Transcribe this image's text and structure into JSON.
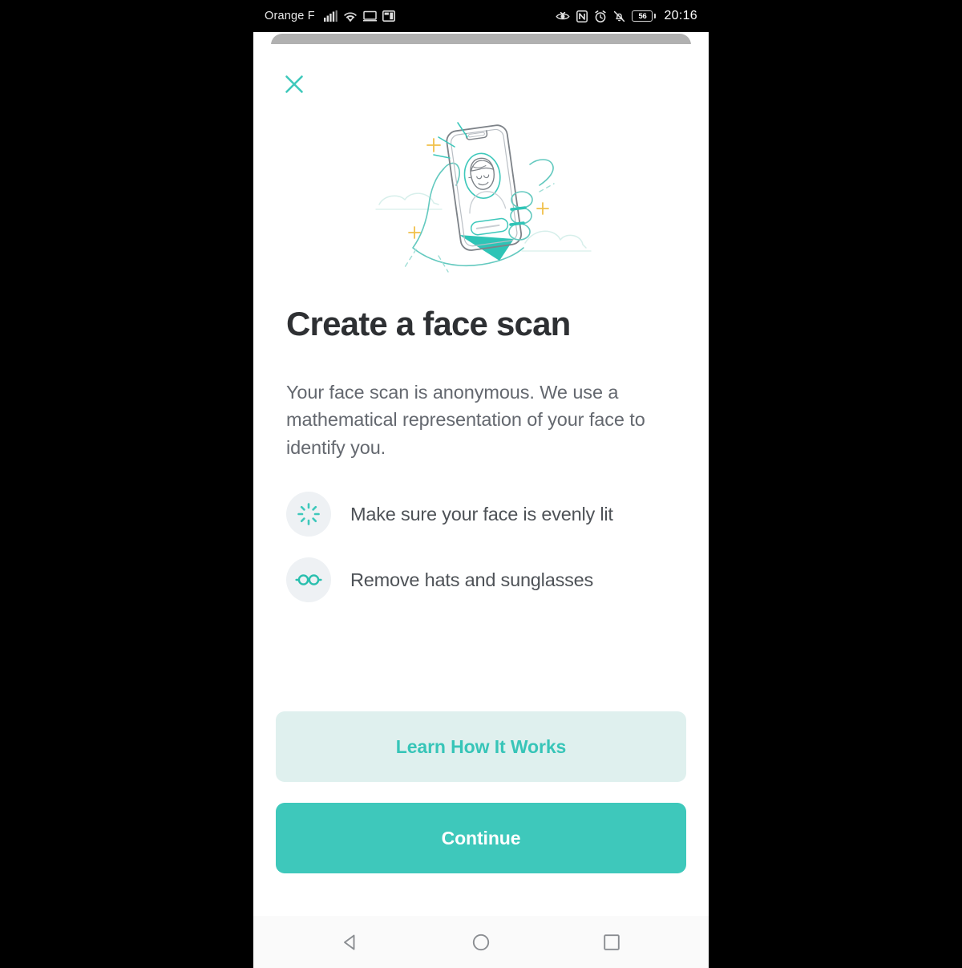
{
  "statusbar": {
    "carrier": "Orange F",
    "time": "20:16",
    "battery_level": "56",
    "left_icons": [
      "cellular-signal-icon",
      "wifi-icon",
      "cast-screen-icon",
      "screenshot-icon"
    ],
    "right_icons": [
      "eye-comfort-icon",
      "nfc-icon",
      "alarm-icon",
      "mute-icon",
      "battery-icon"
    ]
  },
  "sheet": {
    "close_label": "close-icon",
    "illustration": "hand-holding-phone-face-scan-illustration",
    "title": "Create a face scan",
    "subtitle": "Your face scan is anonymous. We use a mathematical representation of your face to identify you.",
    "tips": [
      {
        "icon": "brightness-sun-icon",
        "label": "Make sure your face is evenly lit"
      },
      {
        "icon": "sunglasses-icon",
        "label": "Remove hats and sunglasses"
      }
    ],
    "secondary_button": "Learn How It Works",
    "primary_button": "Continue"
  },
  "navbar": {
    "back": "back-triangle-icon",
    "home": "home-circle-icon",
    "recents": "recents-square-icon"
  },
  "colors": {
    "accent": "#3ec8bb",
    "accent_soft": "#dff0ee",
    "title_text": "#2e3033",
    "body_text": "#64686f",
    "tip_bg": "#eef1f4",
    "card_behind": "#b1b1b1",
    "navbar_bg": "#fafafa"
  }
}
